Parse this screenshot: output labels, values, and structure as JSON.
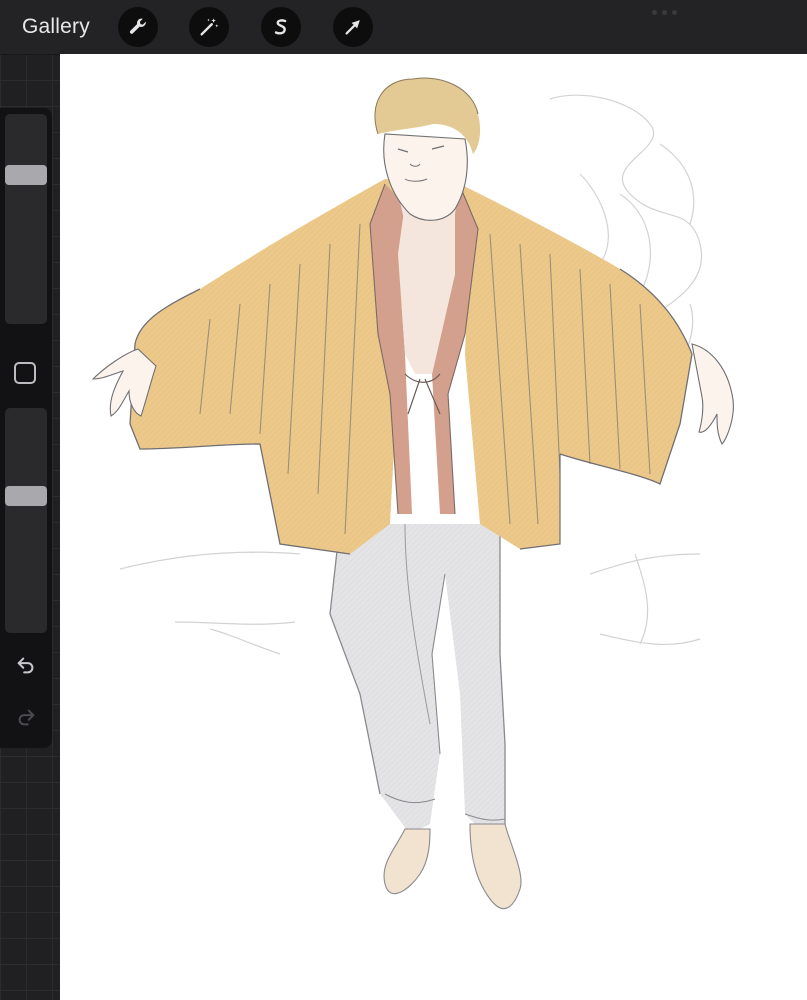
{
  "topbar": {
    "gallery_label": "Gallery",
    "tools": [
      {
        "icon": "wrench-icon",
        "name": "actions"
      },
      {
        "icon": "magic-wand-icon",
        "name": "adjustments"
      },
      {
        "icon": "selection-s-icon",
        "name": "selection"
      },
      {
        "icon": "arrow-cursor-icon",
        "name": "transform"
      }
    ]
  },
  "sidebar": {
    "brush_size_level": 0.73,
    "opacity_level": 0.62,
    "modify_icon": "square-icon",
    "undo_icon": "undo-arrow-icon",
    "redo_icon": "redo-arrow-icon"
  },
  "colors": {
    "toolbar_bg": "#232325",
    "sidebar_bg": "#121214",
    "canvas_bg": "#ffffff",
    "haori_fill": "#ecc98a",
    "collar_fill": "#d4a08e",
    "hair_fill": "#e3c993",
    "pants_fill": "#e4e4e6"
  }
}
